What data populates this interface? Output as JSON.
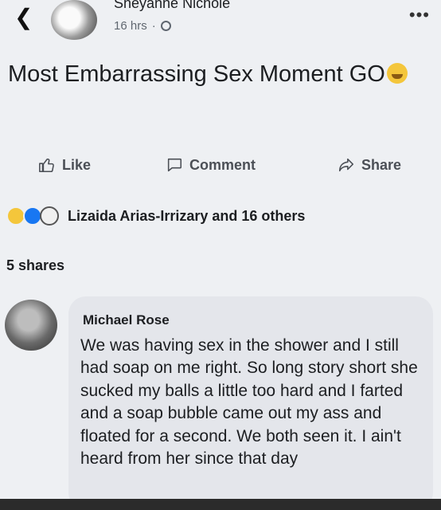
{
  "header": {
    "author": "Sheyanne Nichole",
    "time": "16 hrs",
    "separator": "·"
  },
  "post": {
    "text": "Most Embarrassing Sex Moment GO"
  },
  "actions": {
    "like": "Like",
    "comment": "Comment",
    "share": "Share"
  },
  "reactions": {
    "summary": "Lizaida Arias-Irrizary and 16 others"
  },
  "shares": {
    "label": "5 shares"
  },
  "comment": {
    "author": "Michael Rose",
    "text": "We was having sex in the shower and I still had soap on me right. So long story short she sucked my balls a little too hard and I farted and a soap bubble came out my ass and floated for a second. We both seen it. I ain't heard from her since that day"
  },
  "colors": {
    "like_blue": "#1877f2",
    "haha_yellow": "#f4c63b",
    "background": "#eef0f3"
  }
}
